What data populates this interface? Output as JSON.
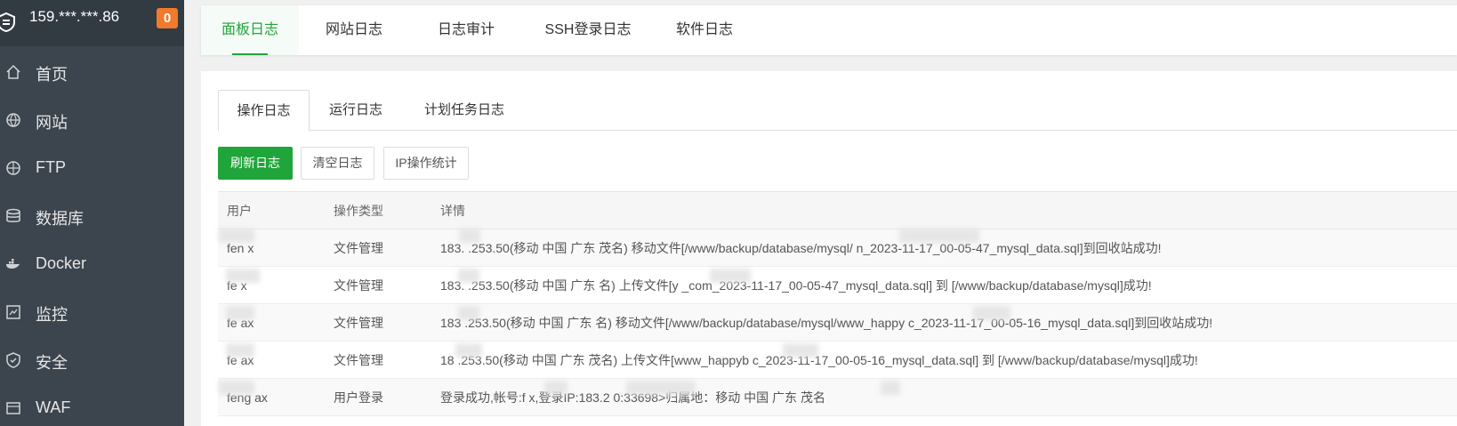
{
  "server": {
    "ip": "159.***.***.86",
    "badge": "0"
  },
  "sidebar": {
    "items": [
      {
        "label": "首页",
        "icon": "home-icon"
      },
      {
        "label": "网站",
        "icon": "globe-icon"
      },
      {
        "label": "FTP",
        "icon": "ftp-globe-icon"
      },
      {
        "label": "数据库",
        "icon": "database-icon"
      },
      {
        "label": "Docker",
        "icon": "docker-icon"
      },
      {
        "label": "监控",
        "icon": "monitor-icon"
      },
      {
        "label": "安全",
        "icon": "shield-icon"
      },
      {
        "label": "WAF",
        "icon": "waf-icon"
      }
    ]
  },
  "top_tabs": [
    "面板日志",
    "网站日志",
    "日志审计",
    "SSH登录日志",
    "软件日志"
  ],
  "sub_tabs": [
    "操作日志",
    "运行日志",
    "计划任务日志"
  ],
  "buttons": {
    "refresh": "刷新日志",
    "clear": "清空日志",
    "ip_stats": "IP操作统计"
  },
  "table": {
    "headers": {
      "user": "用户",
      "type": "操作类型",
      "detail": "详情"
    },
    "rows": [
      {
        "user": "fen   x",
        "type": "文件管理",
        "detail": "183.   .253.50(移动 中国 广东 茂名) 移动文件[/www/backup/database/mysql/              n_2023-11-17_00-05-47_mysql_data.sql]到回收站成功!"
      },
      {
        "user": "fe    x",
        "type": "文件管理",
        "detail": "183.   .253.50(移动 中国 广东   名) 上传文件[y       _com_2023-11-17_00-05-47_mysql_data.sql] 到 [/www/backup/database/mysql]成功!"
      },
      {
        "user": "fe    ax",
        "type": "文件管理",
        "detail": "183    .253.50(移动 中国 广东   名) 移动文件[/www/backup/database/mysql/www_happy       c_2023-11-17_00-05-16_mysql_data.sql]到回收站成功!"
      },
      {
        "user": "fe    ax",
        "type": "文件管理",
        "detail": "18     .253.50(移动 中国 广东 茂名) 上传文件[www_happyb      c_2023-11-17_00-05-16_mysql_data.sql] 到 [/www/backup/database/mysql]成功!"
      },
      {
        "user": "feng ax",
        "type": "用户登录",
        "detail": "登录成功,帐号:f     x,登录IP:183.2         0:33698>归属地：移动 中国 广东 茂名"
      }
    ]
  }
}
